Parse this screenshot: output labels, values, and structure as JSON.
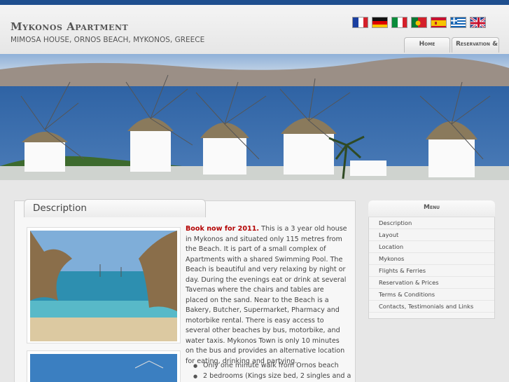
{
  "header": {
    "site_title": "Mykonos Apartment",
    "site_subtitle": "MIMOSA HOUSE, ORNOS BEACH, MYKONOS, GREECE"
  },
  "languages": [
    {
      "name": "French",
      "icon": "flag-fr-icon"
    },
    {
      "name": "German",
      "icon": "flag-de-icon"
    },
    {
      "name": "Italian",
      "icon": "flag-it-icon"
    },
    {
      "name": "Portuguese",
      "icon": "flag-pt-icon"
    },
    {
      "name": "Spanish",
      "icon": "flag-es-icon"
    },
    {
      "name": "Greek",
      "icon": "flag-gr-icon"
    },
    {
      "name": "English",
      "icon": "flag-uk-icon"
    }
  ],
  "nav": {
    "home_label": "Home",
    "reservation_label": "Reservation & Prices"
  },
  "panel": {
    "title": "Description"
  },
  "article": {
    "book_now": "Book now for 2011.",
    "body": " This is a 3 year old house in Mykonos and situated only 115 metres from the Beach. It is part of a small complex of Apartments with a shared Swimming Pool. The Beach is beautiful and very relaxing by night or day. During the evenings eat or drink at several Tavernas where the chairs and tables are placed on the sand. Near to the Beach is a Bakery, Butcher, Supermarket, Pharmacy and motorbike rental. There is easy access to several other beaches by bus, motorbike, and water taxis. Mykonos Town is only 10 minutes on the bus and provides an alternative location for eating, drinking and partying.",
    "features": [
      "Only one minute walk from Ornos beach",
      "2 bedrooms (Kings size bed, 2 singles and a"
    ]
  },
  "menu": {
    "title": "Menu",
    "items": [
      "Description",
      "Layout",
      "Location",
      "Mykonos",
      "Flights & Ferries",
      "Reservation & Prices",
      "Terms & Conditions",
      "Contacts, Testimonials and Links"
    ]
  },
  "colors": {
    "top_bar": "#1f4f8f",
    "book_now": "#b30000",
    "sea": "#2f63a4"
  }
}
